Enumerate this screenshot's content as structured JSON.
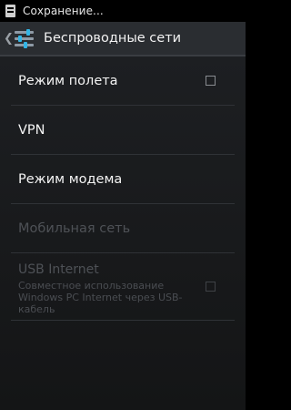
{
  "status_bar": {
    "icon": "sim-card-icon",
    "text": "Сохранение..."
  },
  "action_bar": {
    "up_icon": "chevron-left-icon",
    "app_icon": "settings-sliders-icon",
    "title": "Беспроводные сети"
  },
  "settings": [
    {
      "label": "Режим полета",
      "enabled": true,
      "checkbox": true,
      "checked": false
    },
    {
      "label": "VPN",
      "enabled": true
    },
    {
      "label": "Режим модема",
      "enabled": true
    },
    {
      "label": "Мобильная сеть",
      "enabled": false
    },
    {
      "label": "USB Internet",
      "summary": "Совместное использование Windows PC Internet через USB-кабель",
      "enabled": false,
      "checkbox": true,
      "checked": false
    }
  ],
  "colors": {
    "accent": "#33b5e5",
    "text_enabled": "#f4f4f4",
    "text_disabled": "#4e5156"
  }
}
